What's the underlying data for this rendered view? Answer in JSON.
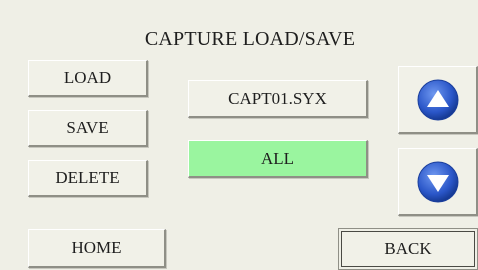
{
  "screen": {
    "title": "CAPTURE LOAD/SAVE"
  },
  "buttons": {
    "load": "LOAD",
    "save": "SAVE",
    "delete": "DELETE",
    "home": "HOME",
    "back": "BACK"
  },
  "file_name": "CAPT01.SYX",
  "scope": "ALL",
  "scroll": {
    "up_icon": "arrow-up-icon",
    "down_icon": "arrow-down-icon"
  },
  "colors": {
    "panel_background": "#efefe6",
    "button_face": "#f1f1e8",
    "scope_highlight": "#9af59f",
    "arrow_blue": "#2a56c8"
  }
}
